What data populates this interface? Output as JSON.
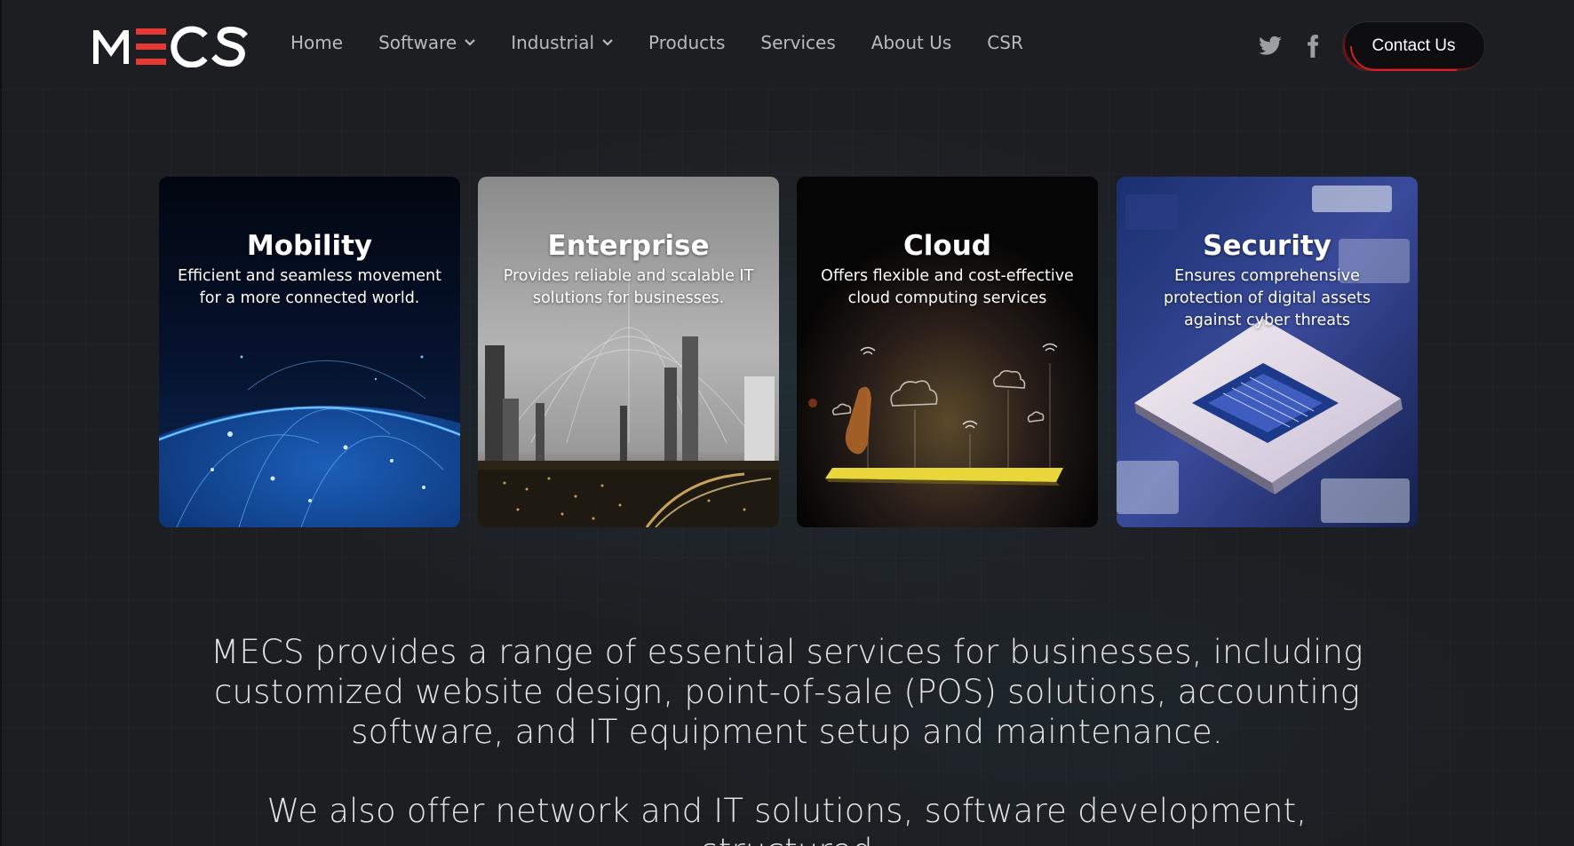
{
  "brand": {
    "logo_text": "MECS",
    "accent": "#e53935"
  },
  "nav": {
    "items": [
      {
        "label": "Home",
        "dropdown": false
      },
      {
        "label": "Software",
        "dropdown": true
      },
      {
        "label": "Industrial",
        "dropdown": true
      },
      {
        "label": "Products",
        "dropdown": false
      },
      {
        "label": "Services",
        "dropdown": false
      },
      {
        "label": "About Us",
        "dropdown": false
      },
      {
        "label": "CSR",
        "dropdown": false
      }
    ]
  },
  "social": {
    "icons": [
      "twitter-icon",
      "facebook-icon"
    ]
  },
  "header": {
    "contact_label": "Contact Us"
  },
  "cards": [
    {
      "title": "Mobility",
      "description": "Efficient and seamless movement for a more connected world."
    },
    {
      "title": "Enterprise",
      "description": "Provides reliable and scalable IT solutions for businesses."
    },
    {
      "title": "Cloud",
      "description": "Offers flexible and cost-effective cloud computing services"
    },
    {
      "title": "Security",
      "description": "Ensures comprehensive protection of digital assets against cyber threats"
    }
  ],
  "content": {
    "intro": "MECS provides a range of essential services for businesses, including customized website design, point-of-sale (POS) solutions, accounting software, and IT equipment setup and maintenance.",
    "intro2": "We also offer network and IT solutions, software development, structured"
  },
  "colors": {
    "background": "#1d1e22",
    "nav_text": "#b9babd",
    "accent_red": "#e53935"
  }
}
